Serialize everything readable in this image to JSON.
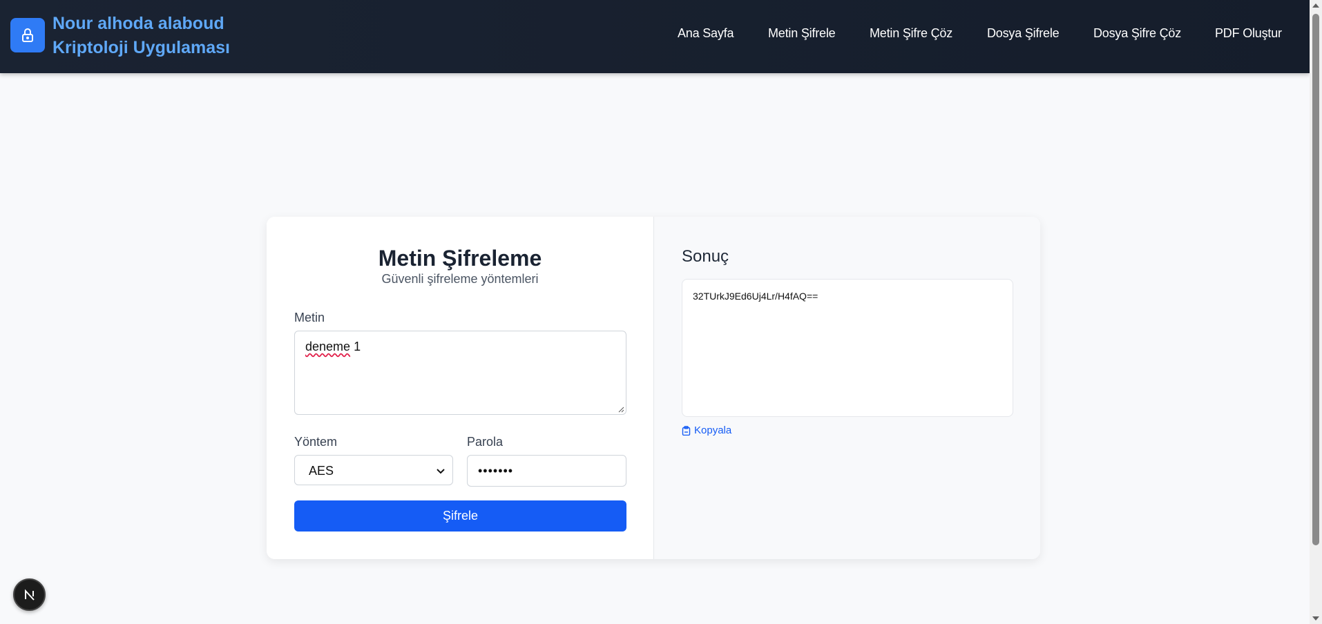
{
  "header": {
    "brand_line1": "Nour alhoda alaboud",
    "brand_line2": "Kriptoloji Uygulaması",
    "logo_icon": "lock-icon",
    "nav": [
      {
        "label": "Ana Sayfa"
      },
      {
        "label": "Metin Şifrele"
      },
      {
        "label": "Metin Şifre Çöz"
      },
      {
        "label": "Dosya Şifrele"
      },
      {
        "label": "Dosya Şifre Çöz"
      },
      {
        "label": "PDF Oluştur"
      }
    ]
  },
  "form": {
    "title": "Metin Şifreleme",
    "subtitle": "Güvenli şifreleme yöntemleri",
    "text_label": "Metin",
    "text_value_word": "deneme",
    "text_value_rest": " 1",
    "method_label": "Yöntem",
    "method_value": "AES",
    "password_label": "Parola",
    "password_value": "•••••••",
    "submit_label": "Şifrele"
  },
  "result": {
    "title": "Sonuç",
    "output": "32TUrkJ9Ed6Uj4Lr/H4fAQ==",
    "copy_label": "Kopyala"
  },
  "colors": {
    "accent": "#155cf5",
    "brand_text": "#5fa8f7",
    "navbar": "#1a2332"
  },
  "badge": {
    "icon": "nextjs-icon",
    "letter": "N"
  }
}
